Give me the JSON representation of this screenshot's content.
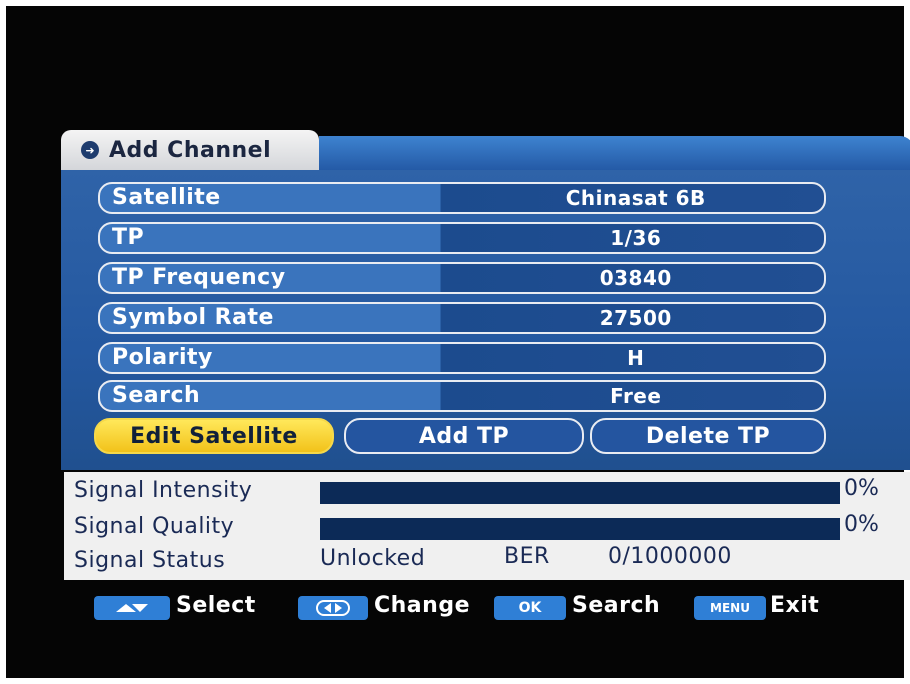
{
  "menu": {
    "title": "Add Channel",
    "icon": "arrow-right-icon"
  },
  "settings": [
    {
      "label": "Satellite",
      "value": "Chinasat 6B"
    },
    {
      "label": "TP",
      "value": "1/36"
    },
    {
      "label": "TP Frequency",
      "value": "03840"
    },
    {
      "label": "Symbol Rate",
      "value": "27500"
    },
    {
      "label": "Polarity",
      "value": "H"
    },
    {
      "label": "Search",
      "value": "Free"
    }
  ],
  "buttons": {
    "edit_satellite": "Edit Satellite",
    "add_tp": "Add TP",
    "delete_tp": "Delete TP",
    "focused": "Edit Satellite"
  },
  "signal": {
    "intensity_label": "Signal Intensity",
    "intensity_value": "0%",
    "intensity_level": 0,
    "quality_label": "Signal Quality",
    "quality_value": "0%",
    "quality_level": 0,
    "status_label": "Signal Status",
    "status_value": "Unlocked",
    "ber_label": "BER",
    "ber_value": "0/1000000"
  },
  "footer": {
    "select_key": "up-down-keys-icon",
    "select_label": "Select",
    "change_key": "left-right-keys-icon",
    "change_label": "Change",
    "ok_key": "OK",
    "search_label": "Search",
    "menu_key": "MENU",
    "exit_label": "Exit"
  },
  "colors": {
    "panel_blue": "#2458a0",
    "focus_yellow": "#f2c21a",
    "bar_navy": "#0c2a57",
    "key_blue": "#2f7fd6"
  }
}
